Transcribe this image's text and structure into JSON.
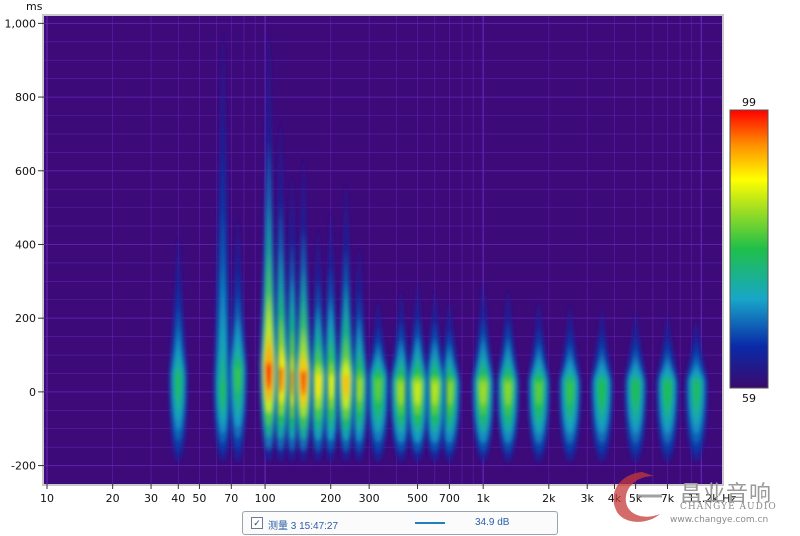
{
  "chart_data": {
    "type": "heatmap",
    "y_unit": "ms",
    "x_unit": "Hz",
    "x_scale": "log",
    "xlim": [
      10,
      11200
    ],
    "ylim": [
      -250,
      1020
    ],
    "x_ticks": [
      {
        "value": 10,
        "label": "10"
      },
      {
        "value": 20,
        "label": "20"
      },
      {
        "value": 30,
        "label": "30"
      },
      {
        "value": 40,
        "label": "40"
      },
      {
        "value": 50,
        "label": "50"
      },
      {
        "value": 70,
        "label": "70"
      },
      {
        "value": 100,
        "label": "100"
      },
      {
        "value": 200,
        "label": "200"
      },
      {
        "value": 300,
        "label": "300"
      },
      {
        "value": 500,
        "label": "500"
      },
      {
        "value": 700,
        "label": "700"
      },
      {
        "value": 1000,
        "label": "1k"
      },
      {
        "value": 2000,
        "label": "2k"
      },
      {
        "value": 3000,
        "label": "3k"
      },
      {
        "value": 4000,
        "label": "4k"
      },
      {
        "value": 5000,
        "label": "5k"
      },
      {
        "value": 7000,
        "label": "7k"
      },
      {
        "value": 11200,
        "label": "11.2k Hz"
      }
    ],
    "y_ticks": [
      {
        "value": 1000,
        "label": "1,000"
      },
      {
        "value": 800,
        "label": "800"
      },
      {
        "value": 600,
        "label": "600"
      },
      {
        "value": 400,
        "label": "400"
      },
      {
        "value": 200,
        "label": "200"
      },
      {
        "value": 0,
        "label": "0"
      },
      {
        "value": -200,
        "label": "-200"
      }
    ],
    "colorbar": {
      "min": 59,
      "max": 99,
      "min_label": "59",
      "max_label": "99"
    },
    "blobs": [
      {
        "freq": 40,
        "time": 40,
        "level": 78,
        "top": 430
      },
      {
        "freq": 64,
        "time": 20,
        "level": 78,
        "top": 1000
      },
      {
        "freq": 75,
        "time": 60,
        "level": 80,
        "top": 480
      },
      {
        "freq": 104,
        "time": 70,
        "level": 99,
        "top": 1000
      },
      {
        "freq": 118,
        "time": 60,
        "level": 95,
        "top": 750
      },
      {
        "freq": 133,
        "time": 50,
        "level": 93,
        "top": 600
      },
      {
        "freq": 150,
        "time": 50,
        "level": 97,
        "top": 650
      },
      {
        "freq": 175,
        "time": 40,
        "level": 90,
        "top": 450
      },
      {
        "freq": 200,
        "time": 40,
        "level": 88,
        "top": 500
      },
      {
        "freq": 235,
        "time": 40,
        "level": 92,
        "top": 580
      },
      {
        "freq": 270,
        "time": 30,
        "level": 85,
        "top": 400
      },
      {
        "freq": 330,
        "time": 30,
        "level": 82,
        "top": 250
      },
      {
        "freq": 420,
        "time": 20,
        "level": 85,
        "top": 280
      },
      {
        "freq": 500,
        "time": 20,
        "level": 87,
        "top": 300
      },
      {
        "freq": 600,
        "time": 20,
        "level": 86,
        "top": 280
      },
      {
        "freq": 700,
        "time": 20,
        "level": 84,
        "top": 250
      },
      {
        "freq": 1000,
        "time": 20,
        "level": 85,
        "top": 300
      },
      {
        "freq": 1300,
        "time": 20,
        "level": 84,
        "top": 280
      },
      {
        "freq": 1800,
        "time": 20,
        "level": 82,
        "top": 250
      },
      {
        "freq": 2500,
        "time": 20,
        "level": 80,
        "top": 240
      },
      {
        "freq": 3500,
        "time": 20,
        "level": 79,
        "top": 230
      },
      {
        "freq": 5000,
        "time": 20,
        "level": 79,
        "top": 220
      },
      {
        "freq": 7000,
        "time": 20,
        "level": 79,
        "top": 210
      },
      {
        "freq": 9500,
        "time": 20,
        "level": 78,
        "top": 200
      }
    ]
  },
  "legend": {
    "checkbox_mark": "✓",
    "series_name": "测量 3 15:47:27",
    "series_value": "34.9 dB",
    "line_color": "#1f7fbf"
  },
  "watermark": {
    "brand": "昌业音响",
    "subtitle": "CHANGYE AUDIO",
    "url": "www.changye.com.cn"
  },
  "colors": {
    "plot_background": "#3d0a7a",
    "grid": "#6a2cc0"
  }
}
